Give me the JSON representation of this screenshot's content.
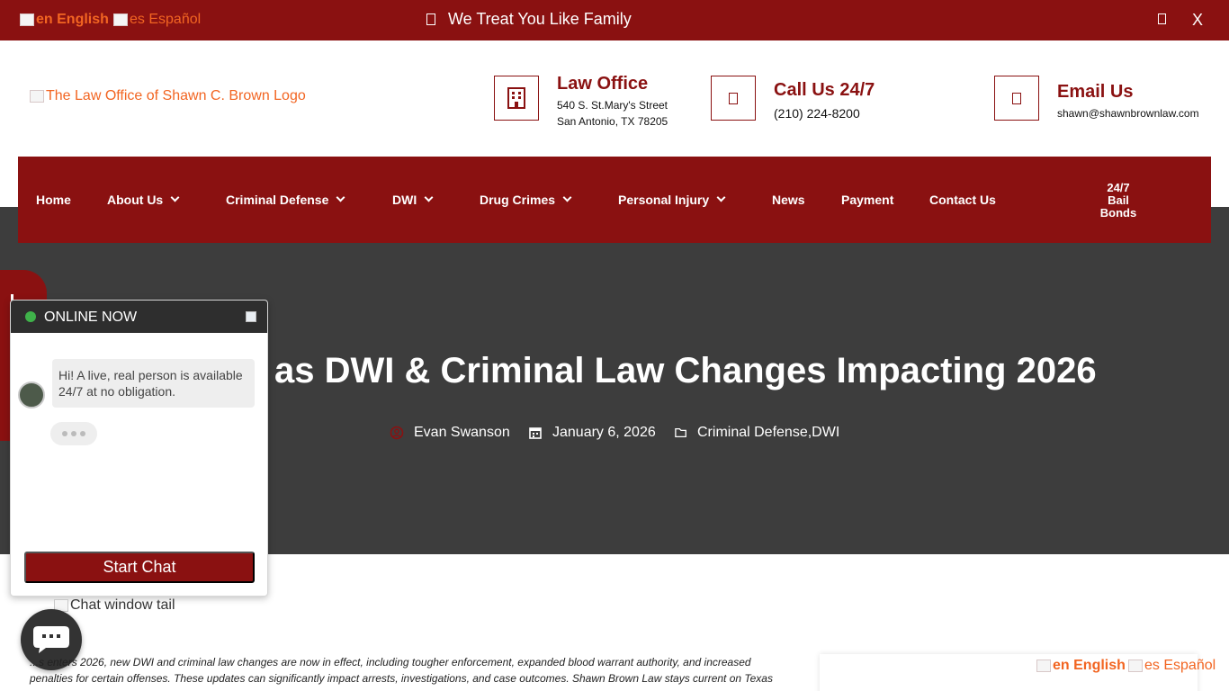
{
  "topbar": {
    "lang_en": "en English",
    "lang_es": "es Español",
    "tagline": "We Treat You Like Family",
    "close": "X"
  },
  "header": {
    "logo_alt": "The Law Office of Shawn C. Brown Logo",
    "office": {
      "title": "Law Office",
      "line1": "540 S. St.Mary's Street",
      "line2": "San Antonio, TX 78205"
    },
    "call": {
      "title": "Call Us 24/7",
      "phone": "(210) 224-8200"
    },
    "email": {
      "title": "Email Us",
      "address": "shawn@shawnbrownlaw.com"
    }
  },
  "nav": {
    "items": [
      {
        "label": "Home"
      },
      {
        "label": "About Us"
      },
      {
        "label": "Criminal Defense"
      },
      {
        "label": "DWI"
      },
      {
        "label": "Drug Crimes"
      },
      {
        "label": "Personal Injury"
      },
      {
        "label": "News"
      },
      {
        "label": "Payment"
      },
      {
        "label": "Contact Us"
      }
    ],
    "bail_line1": "24/7",
    "bail_line2": "Bail",
    "bail_line3": "Bonds"
  },
  "hero": {
    "title": "as DWI & Criminal Law Changes Impacting 2026",
    "author": "Evan Swanson",
    "date": "January 6, 2026",
    "categories": "Criminal Defense,DWI"
  },
  "chat": {
    "status": "ONLINE NOW",
    "message": "Hi! A live, real person is available 24/7 at no obligation.",
    "start_label": "Start Chat",
    "tail_alt": "Chat window tail"
  },
  "article": {
    "intro": "...s enters 2026, new DWI and criminal law changes are now in effect, including tougher enforcement, expanded blood warrant authority, and increased penalties for certain offenses. These updates can significantly impact arrests, investigations, and case outcomes. Shawn Brown Law stays current on Texas"
  },
  "colors": {
    "brand_red": "#8a1111",
    "hero_gray": "#3d3d3d",
    "link_orange": "#f26522",
    "online_green": "#3fb24a"
  }
}
